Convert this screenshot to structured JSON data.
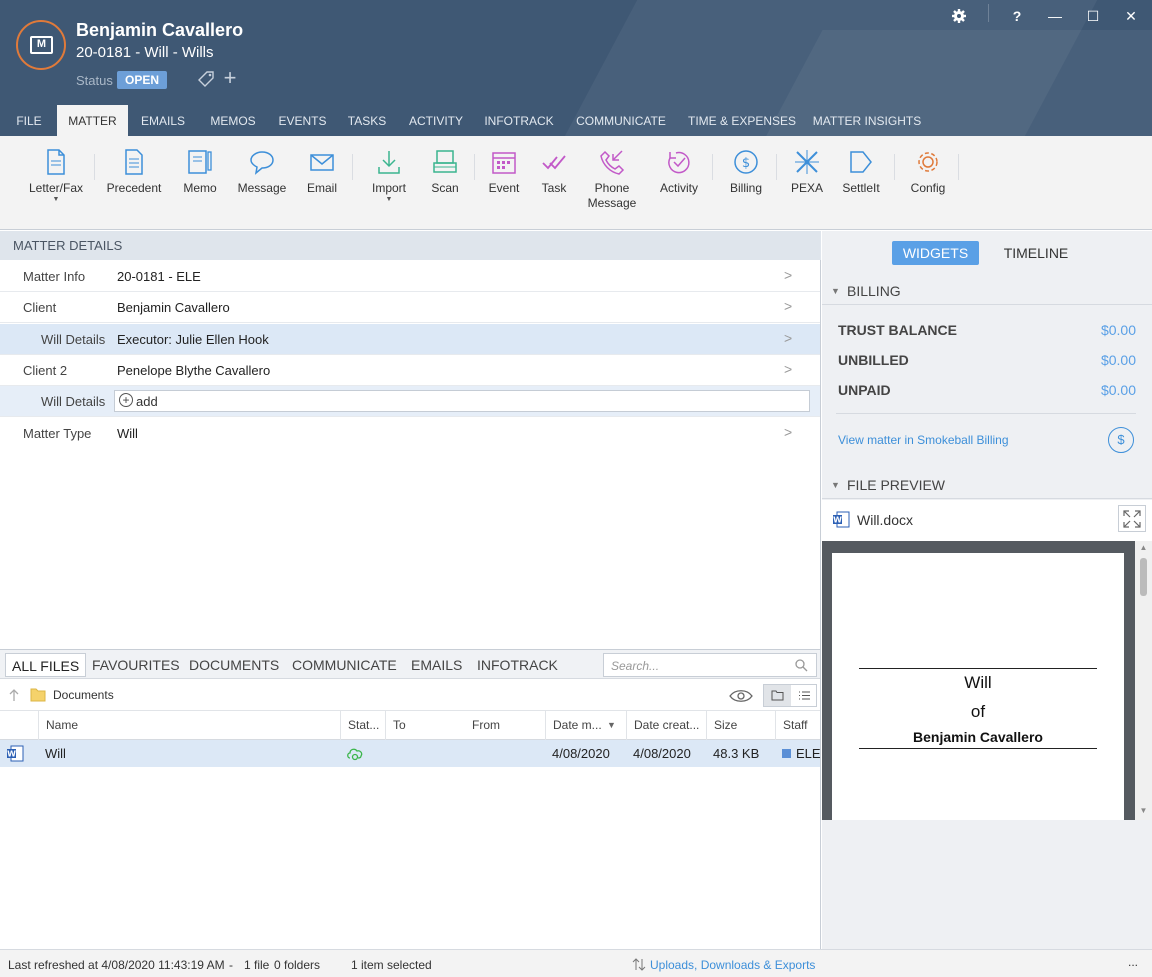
{
  "header": {
    "client_name": "Benjamin Cavallero",
    "matter_line": "20-0181 - Will - Wills",
    "status_label": "Status",
    "status_value": "OPEN",
    "logo_letter": "M",
    "accent_color": "#e07a3a",
    "header_color": "#3f5874"
  },
  "window": {
    "settings_icon": "gear-icon",
    "help": "?",
    "minimize": "—",
    "maximize": "☐",
    "close": "✕"
  },
  "tabs": [
    "FILE",
    "MATTER",
    "EMAILS",
    "MEMOS",
    "EVENTS",
    "TASKS",
    "ACTIVITY",
    "INFOTRACK",
    "COMMUNICATE",
    "TIME & EXPENSES",
    "MATTER INSIGHTS"
  ],
  "active_tab": "MATTER",
  "toolbar": {
    "letter": "Letter/Fax",
    "precedent": "Precedent",
    "memo": "Memo",
    "message": "Message",
    "email": "Email",
    "import": "Import",
    "scan": "Scan",
    "event": "Event",
    "task": "Task",
    "phone_line1": "Phone",
    "phone_line2": "Message",
    "activity": "Activity",
    "billing": "Billing",
    "pexa": "PEXA",
    "settleit": "SettleIt",
    "config": "Config"
  },
  "matter_details": {
    "title": "MATTER DETAILS",
    "rows": [
      {
        "label": "Matter Info",
        "value": "20-0181 - ELE"
      },
      {
        "label": "Client",
        "value": "Benjamin Cavallero"
      },
      {
        "label": "Will Details",
        "value": "Executor: Julie Ellen Hook"
      },
      {
        "label": "Client 2",
        "value": "Penelope Blythe Cavallero"
      },
      {
        "label": "Will Details",
        "value": "add"
      },
      {
        "label": "Matter Type",
        "value": "Will"
      }
    ]
  },
  "files": {
    "tabs": [
      "ALL FILES",
      "FAVOURITES",
      "DOCUMENTS",
      "COMMUNICATE",
      "EMAILS",
      "INFOTRACK"
    ],
    "search_placeholder": "Search...",
    "breadcrumb": "Documents",
    "columns": [
      "Name",
      "Stat...",
      "To",
      "From",
      "Date m...",
      "Date creat...",
      "Size",
      "Staff"
    ],
    "rows": [
      {
        "name": "Will",
        "to": "",
        "from": "",
        "date_modified": "4/08/2020",
        "date_created": "4/08/2020",
        "size": "48.3 KB",
        "staff": "ELE"
      }
    ]
  },
  "statusbar": {
    "refreshed": "Last refreshed at 4/08/2020 11:43:19 AM",
    "sep": "-",
    "file_count": "1 file",
    "folder_count": "0 folders",
    "selected": "1 item selected",
    "uploads": "Uploads, Downloads & Exports",
    "more": "..."
  },
  "right_pane": {
    "widgets": "WIDGETS",
    "timeline": "TIMELINE",
    "billing_title": "BILLING",
    "billing": [
      {
        "label": "TRUST BALANCE",
        "amount": "$0.00"
      },
      {
        "label": "UNBILLED",
        "amount": "$0.00"
      },
      {
        "label": "UNPAID",
        "amount": "$0.00"
      }
    ],
    "billing_link": "View matter in Smokeball Billing",
    "preview_title": "FILE PREVIEW",
    "preview_file": "Will.docx",
    "doc_line1": "Will",
    "doc_line2": "of",
    "doc_line3": "Benjamin Cavallero"
  }
}
